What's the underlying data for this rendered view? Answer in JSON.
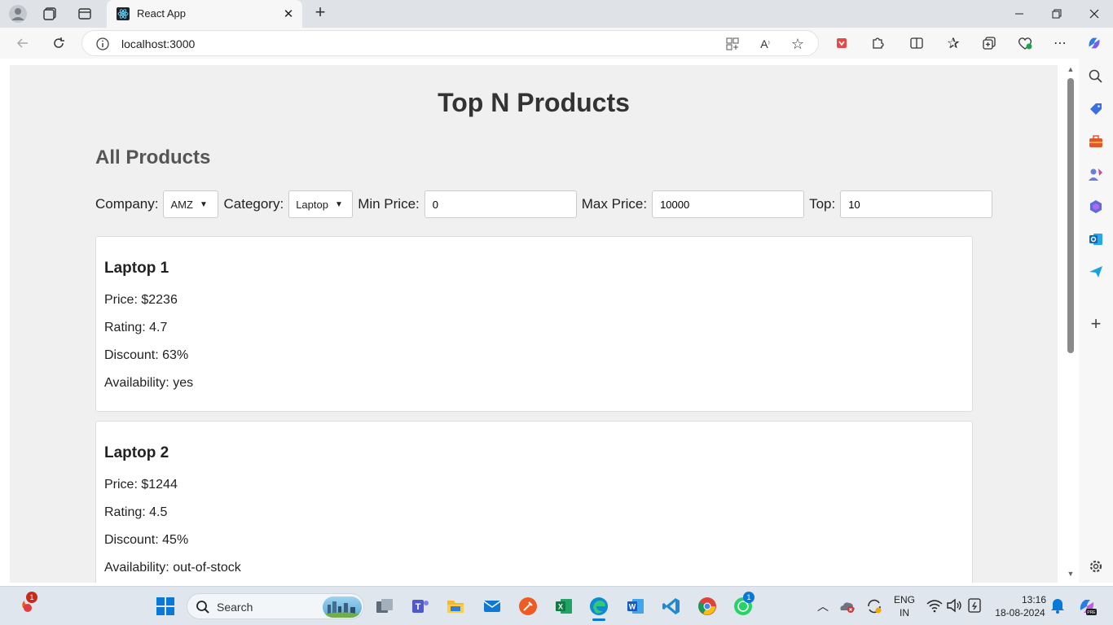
{
  "browser": {
    "tab": {
      "title": "React App"
    },
    "address_bar": {
      "url": "localhost:3000"
    }
  },
  "page": {
    "title": "Top N Products",
    "section_title": "All Products",
    "filters": {
      "company_label": "Company:",
      "company_value": "AMZ",
      "category_label": "Category:",
      "category_value": "Laptop",
      "min_price_label": "Min Price:",
      "min_price_value": "0",
      "max_price_label": "Max Price:",
      "max_price_value": "10000",
      "top_label": "Top:",
      "top_value": "10"
    },
    "products": [
      {
        "name": "Laptop 1",
        "price": "Price: $2236",
        "rating": "Rating: 4.7",
        "discount": "Discount: 63%",
        "availability": "Availability: yes"
      },
      {
        "name": "Laptop 2",
        "price": "Price: $1244",
        "rating": "Rating: 4.5",
        "discount": "Discount: 45%",
        "availability": "Availability: out-of-stock"
      }
    ]
  },
  "taskbar": {
    "search_label": "Search",
    "language": "ENG",
    "region": "IN",
    "time": "13:16",
    "date": "18-08-2024",
    "notification_badge": "1",
    "whatsapp_badge": "1"
  },
  "colors": {
    "page_background": "#f0f0f0",
    "heading": "#333333",
    "section_heading": "#555555",
    "card_border": "#dddddd"
  }
}
